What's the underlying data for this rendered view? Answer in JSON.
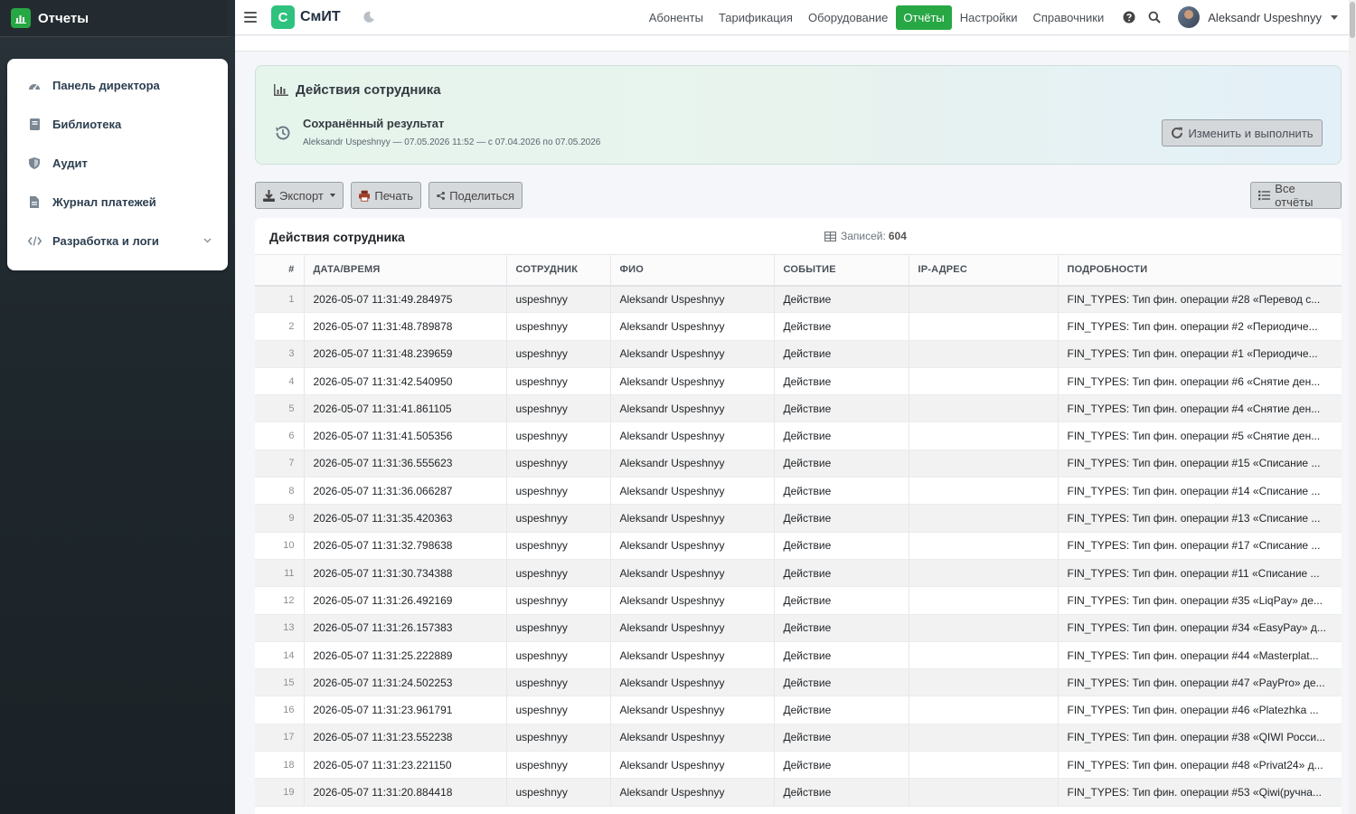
{
  "sidebar": {
    "brand": "Отчеты",
    "items": [
      {
        "label": "Панель директора",
        "icon": "gauge-icon"
      },
      {
        "label": "Библиотека",
        "icon": "book-icon"
      },
      {
        "label": "Аудит",
        "icon": "shield-icon"
      },
      {
        "label": "Журнал платежей",
        "icon": "file-icon"
      },
      {
        "label": "Разработка и логи",
        "icon": "code-icon",
        "has_submenu": true
      }
    ]
  },
  "topbar": {
    "logo_letter": "С",
    "logo_text": "СмИТ",
    "nav": [
      "Абоненты",
      "Тарификация",
      "Оборудование",
      "Отчёты",
      "Настройки",
      "Справочники"
    ],
    "active_nav": "Отчёты",
    "user_name": "Aleksandr Uspeshnyy"
  },
  "result": {
    "title": "Действия сотрудника",
    "subtitle": "Сохранённый результат",
    "meta": "Aleksandr Uspeshnyy — 07.05.2026 11:52 — с 07.04.2026 по 07.05.2026",
    "rerun_label": "Изменить и выполнить"
  },
  "toolbar": {
    "export_label": "Экспорт",
    "print_label": "Печать",
    "share_label": "Поделиться",
    "all_reports_label": "Все отчёты"
  },
  "table": {
    "title": "Действия сотрудника",
    "count_label": "Записей:",
    "count_value": "604",
    "columns": [
      "#",
      "ДАТА/ВРЕМЯ",
      "СОТРУДНИК",
      "ФИО",
      "СОБЫТИЕ",
      "IP-АДРЕС",
      "ПОДРОБНОСТИ"
    ],
    "rows": [
      [
        "1",
        "2026-05-07 11:31:49.284975",
        "uspeshnyy",
        "Aleksandr Uspeshnyy",
        "Действие",
        "",
        "FIN_TYPES: Тип фин. операции #28 «Перевод с..."
      ],
      [
        "2",
        "2026-05-07 11:31:48.789878",
        "uspeshnyy",
        "Aleksandr Uspeshnyy",
        "Действие",
        "",
        "FIN_TYPES: Тип фин. операции #2 «Периодиче..."
      ],
      [
        "3",
        "2026-05-07 11:31:48.239659",
        "uspeshnyy",
        "Aleksandr Uspeshnyy",
        "Действие",
        "",
        "FIN_TYPES: Тип фин. операции #1 «Периодиче..."
      ],
      [
        "4",
        "2026-05-07 11:31:42.540950",
        "uspeshnyy",
        "Aleksandr Uspeshnyy",
        "Действие",
        "",
        "FIN_TYPES: Тип фин. операции #6 «Снятие ден..."
      ],
      [
        "5",
        "2026-05-07 11:31:41.861105",
        "uspeshnyy",
        "Aleksandr Uspeshnyy",
        "Действие",
        "",
        "FIN_TYPES: Тип фин. операции #4 «Снятие ден..."
      ],
      [
        "6",
        "2026-05-07 11:31:41.505356",
        "uspeshnyy",
        "Aleksandr Uspeshnyy",
        "Действие",
        "",
        "FIN_TYPES: Тип фин. операции #5 «Снятие ден..."
      ],
      [
        "7",
        "2026-05-07 11:31:36.555623",
        "uspeshnyy",
        "Aleksandr Uspeshnyy",
        "Действие",
        "",
        "FIN_TYPES: Тип фин. операции #15 «Списание ..."
      ],
      [
        "8",
        "2026-05-07 11:31:36.066287",
        "uspeshnyy",
        "Aleksandr Uspeshnyy",
        "Действие",
        "",
        "FIN_TYPES: Тип фин. операции #14 «Списание ..."
      ],
      [
        "9",
        "2026-05-07 11:31:35.420363",
        "uspeshnyy",
        "Aleksandr Uspeshnyy",
        "Действие",
        "",
        "FIN_TYPES: Тип фин. операции #13 «Списание ..."
      ],
      [
        "10",
        "2026-05-07 11:31:32.798638",
        "uspeshnyy",
        "Aleksandr Uspeshnyy",
        "Действие",
        "",
        "FIN_TYPES: Тип фин. операции #17 «Списание ..."
      ],
      [
        "11",
        "2026-05-07 11:31:30.734388",
        "uspeshnyy",
        "Aleksandr Uspeshnyy",
        "Действие",
        "",
        "FIN_TYPES: Тип фин. операции #11 «Списание ..."
      ],
      [
        "12",
        "2026-05-07 11:31:26.492169",
        "uspeshnyy",
        "Aleksandr Uspeshnyy",
        "Действие",
        "",
        "FIN_TYPES: Тип фин. операции #35 «LiqPay» де..."
      ],
      [
        "13",
        "2026-05-07 11:31:26.157383",
        "uspeshnyy",
        "Aleksandr Uspeshnyy",
        "Действие",
        "",
        "FIN_TYPES: Тип фин. операции #34 «EasyPay» д..."
      ],
      [
        "14",
        "2026-05-07 11:31:25.222889",
        "uspeshnyy",
        "Aleksandr Uspeshnyy",
        "Действие",
        "",
        "FIN_TYPES: Тип фин. операции #44 «Masterplat..."
      ],
      [
        "15",
        "2026-05-07 11:31:24.502253",
        "uspeshnyy",
        "Aleksandr Uspeshnyy",
        "Действие",
        "",
        "FIN_TYPES: Тип фин. операции #47 «PayPro» де..."
      ],
      [
        "16",
        "2026-05-07 11:31:23.961791",
        "uspeshnyy",
        "Aleksandr Uspeshnyy",
        "Действие",
        "",
        "FIN_TYPES: Тип фин. операции #46 «Platezhka ..."
      ],
      [
        "17",
        "2026-05-07 11:31:23.552238",
        "uspeshnyy",
        "Aleksandr Uspeshnyy",
        "Действие",
        "",
        "FIN_TYPES: Тип фин. операции #38 «QIWI Росси..."
      ],
      [
        "18",
        "2026-05-07 11:31:23.221150",
        "uspeshnyy",
        "Aleksandr Uspeshnyy",
        "Действие",
        "",
        "FIN_TYPES: Тип фин. операции #48 «Privat24» д..."
      ],
      [
        "19",
        "2026-05-07 11:31:20.884418",
        "uspeshnyy",
        "Aleksandr Uspeshnyy",
        "Действие",
        "",
        "FIN_TYPES: Тип фин. операции #53 «Qiwi(ручна..."
      ]
    ]
  },
  "colors": {
    "accent": "#28a745",
    "logo_green": "#2ec27e",
    "sidebar_bg": "#1f282d"
  }
}
